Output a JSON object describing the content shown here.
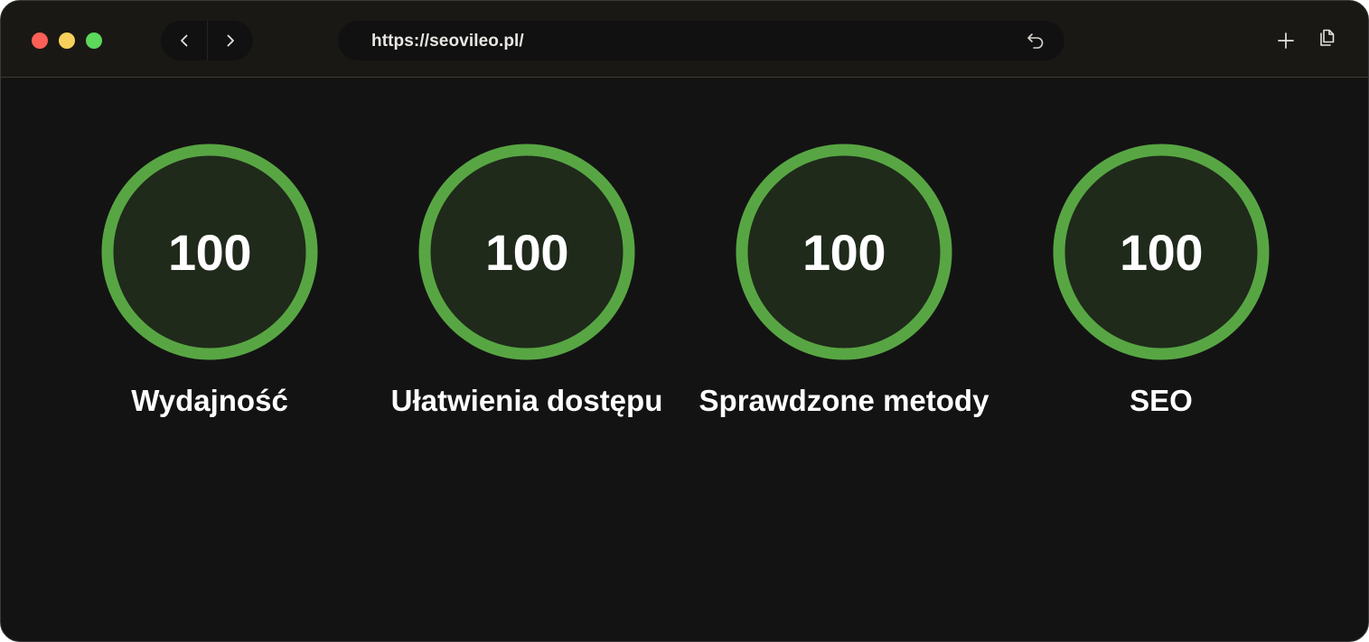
{
  "browser": {
    "url": "https://seovileo.pl/",
    "icons": {
      "back": "chevron-left-icon",
      "forward": "chevron-right-icon",
      "reload": "reload-icon",
      "new_tab": "plus-icon",
      "tabs": "copy-icon"
    }
  },
  "colors": {
    "gauge_ring": "#58a643",
    "gauge_fill": "#1f2a1b",
    "background": "#141314",
    "toolbar": "#1a1815"
  },
  "scores": [
    {
      "label": "Wydajność",
      "value": "100"
    },
    {
      "label": "Ułatwienia dostępu",
      "value": "100"
    },
    {
      "label": "Sprawdzone metody",
      "value": "100"
    },
    {
      "label": "SEO",
      "value": "100"
    }
  ]
}
